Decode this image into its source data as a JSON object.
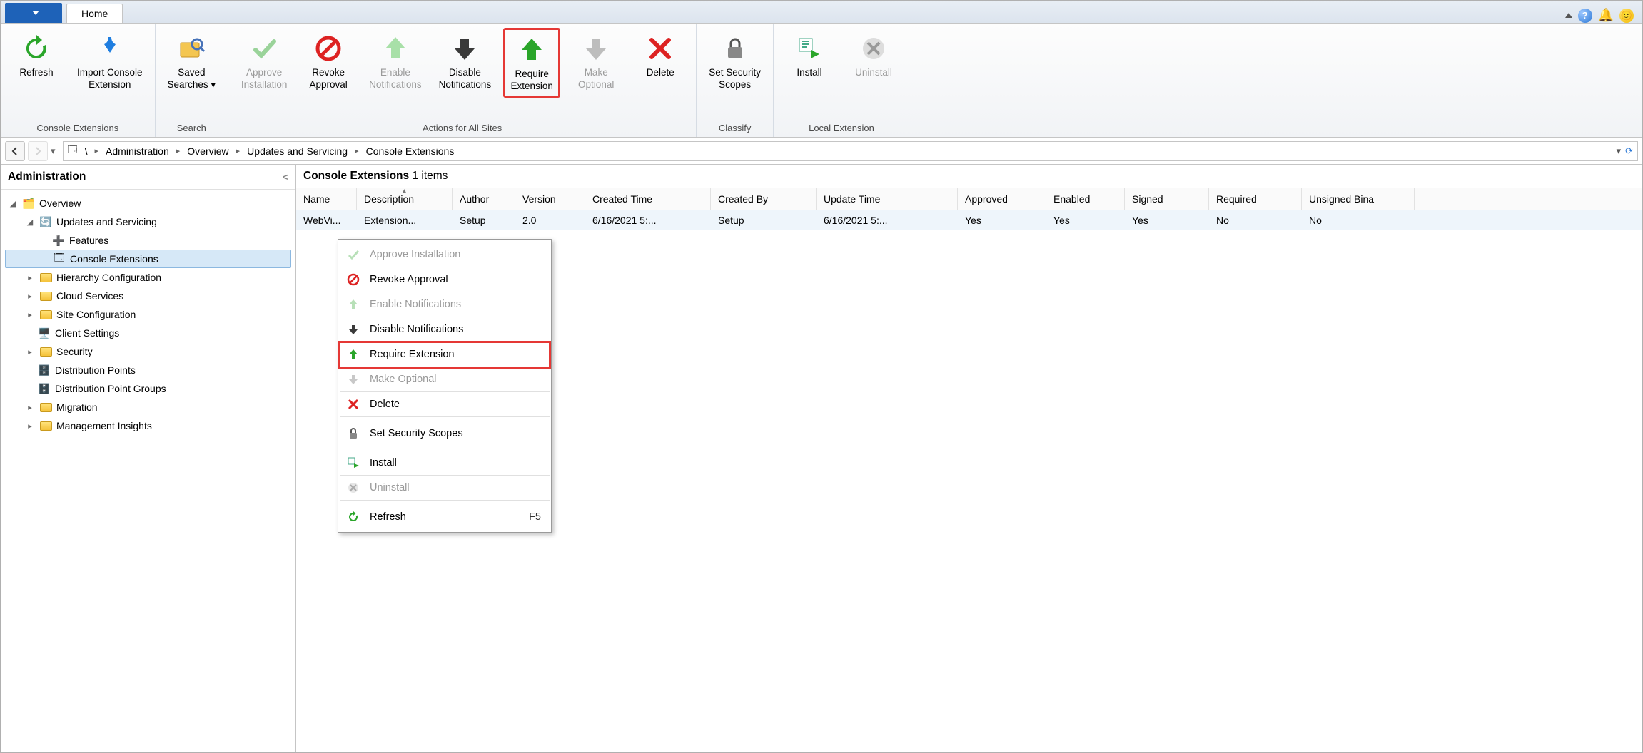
{
  "tabs": {
    "home": "Home"
  },
  "ribbon": {
    "groups": {
      "console_ext": "Console Extensions",
      "search": "Search",
      "actions": "Actions for All Sites",
      "classify": "Classify",
      "local": "Local Extension"
    },
    "refresh": "Refresh",
    "import": "Import Console\nExtension",
    "saved_searches": "Saved\nSearches ▾",
    "approve": "Approve\nInstallation",
    "revoke": "Revoke\nApproval",
    "enable_notif": "Enable\nNotifications",
    "disable_notif": "Disable\nNotifications",
    "require": "Require\nExtension",
    "make_opt": "Make\nOptional",
    "delete": "Delete",
    "scopes": "Set Security\nScopes",
    "install": "Install",
    "uninstall": "Uninstall"
  },
  "breadcrumb": {
    "root": "\\",
    "items": [
      "Administration",
      "Overview",
      "Updates and Servicing",
      "Console Extensions"
    ]
  },
  "sidebar": {
    "title": "Administration",
    "overview": "Overview",
    "updates": "Updates and Servicing",
    "features": "Features",
    "console_ext": "Console Extensions",
    "hierarchy": "Hierarchy Configuration",
    "cloud": "Cloud Services",
    "siteconf": "Site Configuration",
    "client": "Client Settings",
    "security": "Security",
    "dist_points": "Distribution Points",
    "dist_groups": "Distribution Point Groups",
    "migration": "Migration",
    "mgmt": "Management Insights"
  },
  "content": {
    "title": "Console Extensions",
    "count": "1 items",
    "columns": {
      "name": "Name",
      "desc": "Description",
      "author": "Author",
      "version": "Version",
      "created_time": "Created Time",
      "created_by": "Created By",
      "update_time": "Update Time",
      "approved": "Approved",
      "enabled": "Enabled",
      "signed": "Signed",
      "required": "Required",
      "unsigned": "Unsigned Bina"
    },
    "row": {
      "name": "WebVi...",
      "desc": "Extension...",
      "author": "Setup",
      "version": "2.0",
      "created_time": "6/16/2021 5:...",
      "created_by": "Setup",
      "update_time": "6/16/2021 5:...",
      "approved": "Yes",
      "enabled": "Yes",
      "signed": "Yes",
      "required": "No",
      "unsigned": "No"
    }
  },
  "ctx": {
    "approve": "Approve Installation",
    "revoke": "Revoke Approval",
    "enable_notif": "Enable Notifications",
    "disable_notif": "Disable Notifications",
    "require": "Require Extension",
    "make_opt": "Make Optional",
    "delete": "Delete",
    "scopes": "Set Security Scopes",
    "install": "Install",
    "uninstall": "Uninstall",
    "refresh": "Refresh",
    "refresh_key": "F5"
  }
}
